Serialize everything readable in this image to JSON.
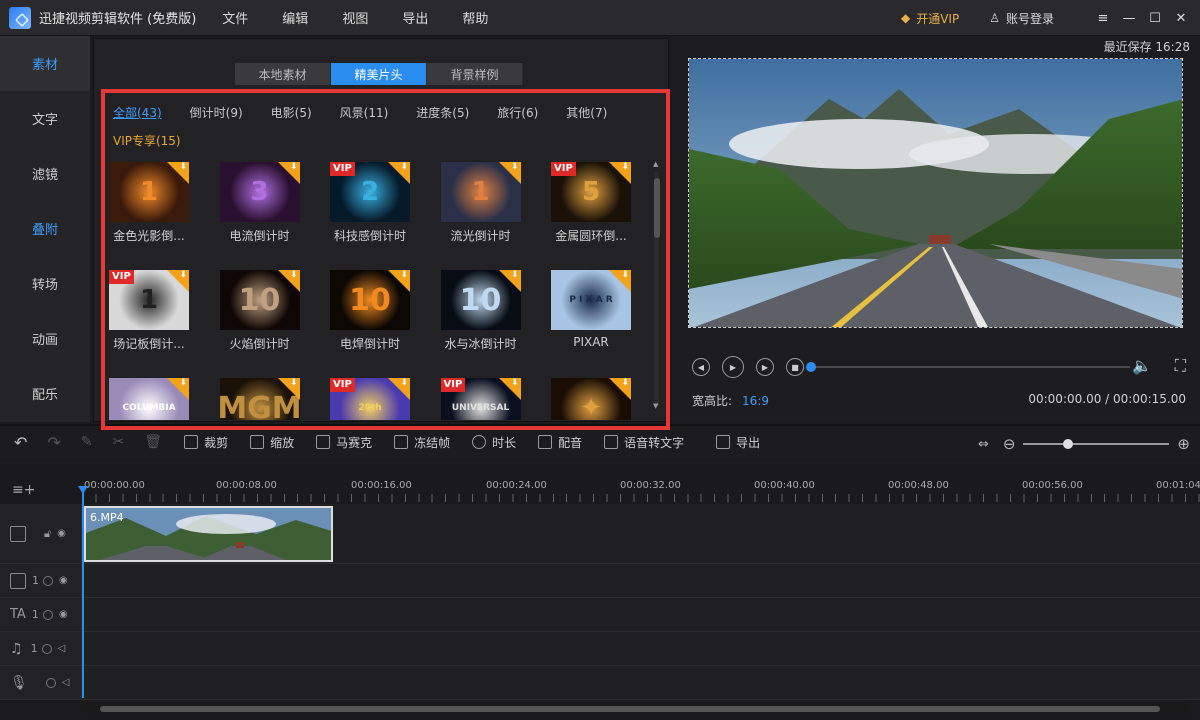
{
  "app": {
    "title": "迅捷视频剪辑软件 (免费版)",
    "menu": [
      "文件",
      "编辑",
      "视图",
      "导出",
      "帮助"
    ],
    "vip_label": "开通VIP",
    "account_label": "账号登录",
    "window_controls": [
      "≡",
      "—",
      "☐",
      "✕"
    ]
  },
  "sidebar": {
    "items": [
      {
        "label": "素材",
        "active": true
      },
      {
        "label": "文字",
        "active": false
      },
      {
        "label": "滤镜",
        "active": false
      },
      {
        "label": "叠附",
        "active": true
      },
      {
        "label": "转场",
        "active": false
      },
      {
        "label": "动画",
        "active": false
      },
      {
        "label": "配乐",
        "active": false
      }
    ]
  },
  "library": {
    "tabs": [
      {
        "label": "本地素材",
        "active": false
      },
      {
        "label": "精美片头",
        "active": true
      },
      {
        "label": "背景样例",
        "active": false
      }
    ],
    "filters": [
      {
        "label": "全部(43)",
        "active": true
      },
      {
        "label": "倒计时(9)"
      },
      {
        "label": "电影(5)"
      },
      {
        "label": "风景(11)"
      },
      {
        "label": "进度条(5)"
      },
      {
        "label": "旅行(6)"
      },
      {
        "label": "其他(7)"
      }
    ],
    "vip_filter": "VIP专享(15)",
    "items": [
      {
        "caption": "金色光影倒...",
        "vip": false,
        "glyph": "1",
        "bg": "#3a1a0a",
        "glow": "#f08a2a"
      },
      {
        "caption": "电流倒计时",
        "vip": false,
        "glyph": "3",
        "bg": "#2a1030",
        "glow": "#b070e0"
      },
      {
        "caption": "科技感倒计时",
        "vip": true,
        "glyph": "2",
        "bg": "#061a2a",
        "glow": "#3ab0e0"
      },
      {
        "caption": "流光倒计时",
        "vip": false,
        "glyph": "1",
        "bg": "#2a3048",
        "glow": "#e08040"
      },
      {
        "caption": "金属圆环倒...",
        "vip": true,
        "glyph": "5",
        "bg": "#1a1208",
        "glow": "#e0a040"
      },
      {
        "caption": "场记板倒计...",
        "vip": true,
        "glyph": "1",
        "bg": "#d8d8d8",
        "glow": "#222222"
      },
      {
        "caption": "火焰倒计时",
        "vip": false,
        "glyph": "10",
        "bg": "#100806",
        "glow": "#c0a080"
      },
      {
        "caption": "电焊倒计时",
        "vip": false,
        "glyph": "10",
        "bg": "#0c0804",
        "glow": "#f08a20"
      },
      {
        "caption": "水与冰倒计时",
        "vip": false,
        "glyph": "10",
        "bg": "#080c14",
        "glow": "#c0d8f0"
      },
      {
        "caption": "PIXAR",
        "vip": false,
        "glyph": "P I X A R",
        "bg": "#a8c4e4",
        "glow": "#1a2a4a"
      },
      {
        "caption": "",
        "vip": false,
        "glyph": "COLUMBIA",
        "bg": "#9a8ab8",
        "glow": "#ffffff"
      },
      {
        "caption": "",
        "vip": false,
        "glyph": "MGM",
        "bg": "#1a1208",
        "glow": "#c09040"
      },
      {
        "caption": "",
        "vip": true,
        "glyph": "20th",
        "bg": "#4a3ab0",
        "glow": "#f0d060"
      },
      {
        "caption": "",
        "vip": true,
        "glyph": "UNIVERSAL",
        "bg": "#0a1020",
        "glow": "#e0e0e0"
      },
      {
        "caption": "",
        "vip": false,
        "glyph": "✦",
        "bg": "#1a0e04",
        "glow": "#e0a040"
      }
    ]
  },
  "preview": {
    "autosave": "最近保存 16:28",
    "aspect_label": "宽高比:",
    "aspect_value": "16:9",
    "timecode": "00:00:00.00 / 00:00:15.00",
    "progress": 0
  },
  "toolbar": {
    "tools": [
      {
        "label": "裁剪",
        "icon": "crop-icon",
        "dim": false
      },
      {
        "label": "缩放",
        "icon": "zoom-icon",
        "dim": false
      },
      {
        "label": "马赛克",
        "icon": "mosaic-icon",
        "dim": false
      },
      {
        "label": "冻结帧",
        "icon": "freeze-icon",
        "dim": false
      },
      {
        "label": "时长",
        "icon": "clock-icon",
        "dim": false
      },
      {
        "label": "配音",
        "icon": "mic-icon",
        "dim": false
      },
      {
        "label": "语音转文字",
        "icon": "speech-text-icon",
        "dim": false
      },
      {
        "label": "导出",
        "icon": "export-icon",
        "dim": false
      }
    ]
  },
  "timeline": {
    "ruler_labels": [
      "00:00:00.00",
      "00:00:08.00",
      "00:00:16.00",
      "00:00:24.00",
      "00:00:32.00",
      "00:00:40.00",
      "00:00:48.00",
      "00:00:56.00",
      "00:01:04"
    ],
    "clip_name": "6.MP4",
    "track_numbers": [
      "1",
      "1",
      "1"
    ]
  }
}
